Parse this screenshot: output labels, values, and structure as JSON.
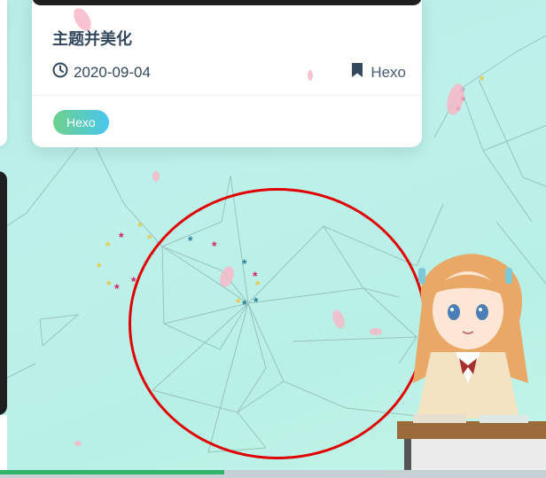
{
  "post": {
    "title": "主题并美化",
    "date": "2020-09-04",
    "category": "Hexo",
    "tag": "Hexo"
  },
  "icons": {
    "date": "clock-icon",
    "category": "bookmark-icon"
  },
  "colors": {
    "background": "#b9efe7",
    "annotation_ring": "#e00000",
    "tag_gradient_start": "#6fd08a",
    "tag_gradient_end": "#48c7ef",
    "progress": "#32b46d",
    "text": "#34495e"
  },
  "progress": 0.41
}
